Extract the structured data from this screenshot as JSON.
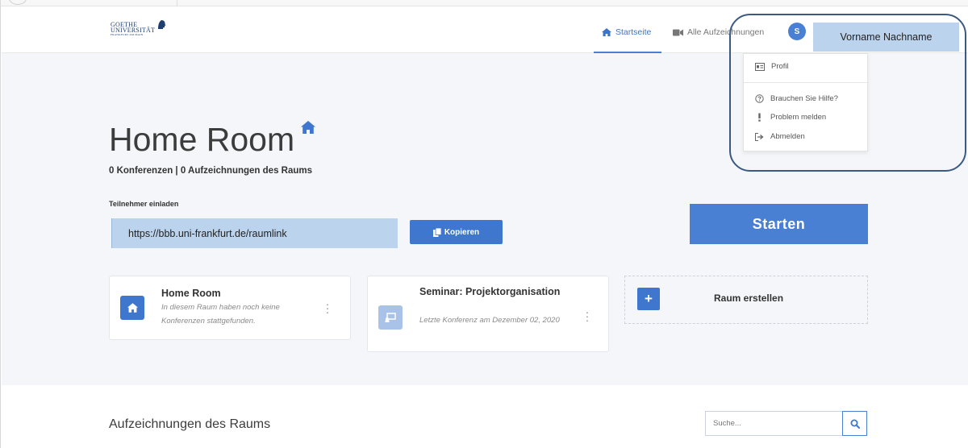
{
  "nav": {
    "logo": {
      "line1": "GOETHE",
      "line2": "UNIVERSITÄT",
      "line3": "FRANKFURT AM MAIN"
    },
    "home": "Startseite",
    "recordings": "Alle Aufzeichnungen",
    "avatar_initial": "S",
    "user_name": "Vorname Nachname"
  },
  "dropdown": {
    "items": [
      "Profil",
      "Brauchen Sie Hilfe?",
      "Problem melden",
      "Abmelden"
    ]
  },
  "room": {
    "title": "Home Room",
    "stats": "0 Konferenzen | 0 Aufzeichnungen des Raums",
    "invite_label": "Teilnehmer einladen",
    "invite_link": "https://bbb.uni-frankfurt.de/raumlink",
    "copy_button": "Kopieren",
    "start_button": "Starten"
  },
  "cards": [
    {
      "title": "Home Room",
      "desc": "In diesem Raum haben noch keine Konferenzen stattgefunden."
    },
    {
      "title": "Seminar: Projektorganisation",
      "desc": "Letzte Konferenz am Dezember 02, 2020"
    }
  ],
  "create_room": "Raum erstellen",
  "recordings_section": {
    "title": "Aufzeichnungen des Raums",
    "search_placeholder": "Suche..."
  },
  "colors": {
    "accent": "#4a80d4",
    "highlight_box": "#bcd3ed",
    "highlight_ring": "#3a5a83"
  }
}
